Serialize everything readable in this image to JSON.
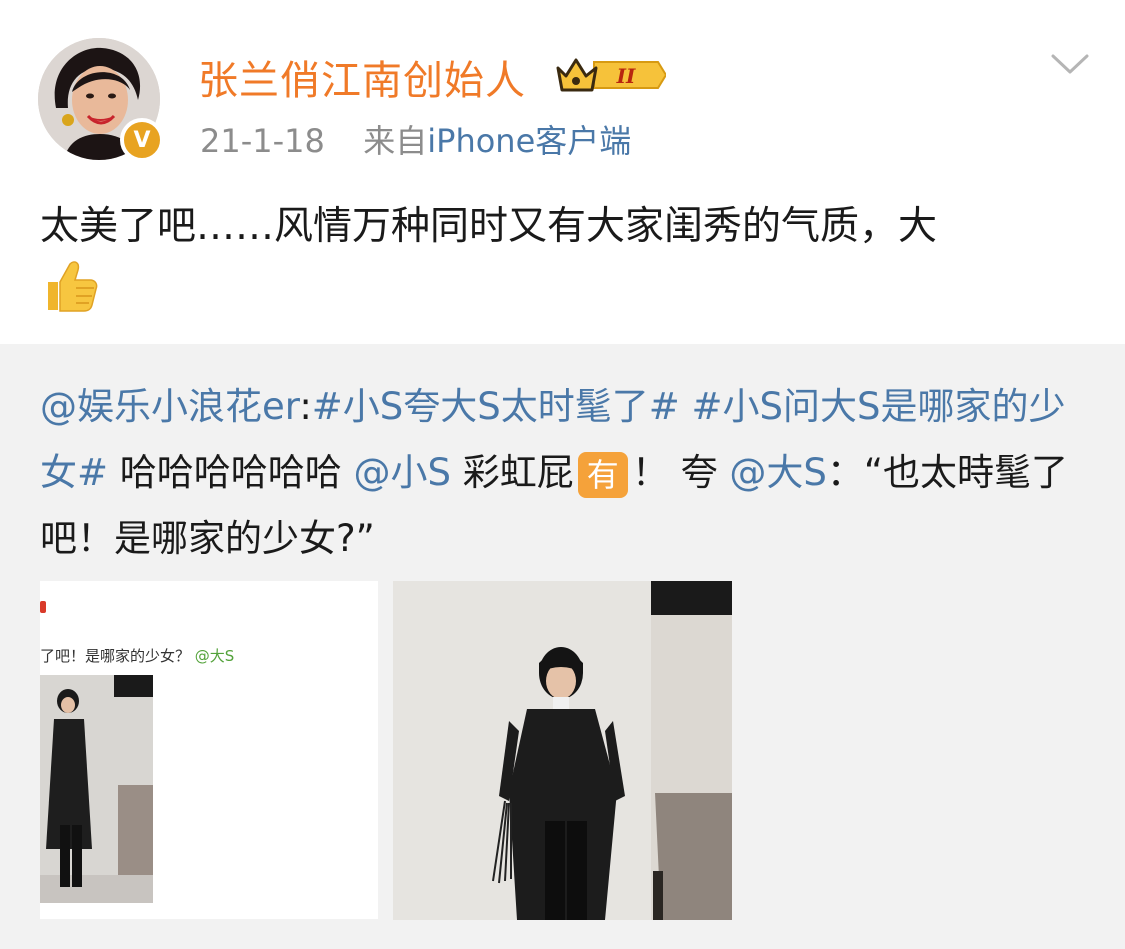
{
  "header": {
    "username": "张兰俏江南创始人",
    "vip_level": "II",
    "verified_mark": "V",
    "date": "21-1-18",
    "source_prefix": "来自",
    "source_device": "iPhone",
    "source_suffix": "客户端"
  },
  "post": {
    "text": "太美了吧……风情万种同时又有大家闺秀的气质，大",
    "emoji": "thumbs-up-icon"
  },
  "repost": {
    "mention_author": "@娱乐小浪花er",
    "colon": ":",
    "hashtag1": "#小S夸大S太时髦了#",
    "hashtag2": "#小S问大S是哪家的少女#",
    "laugh": " 哈哈哈哈哈哈",
    "mention_xiaos": "@小S",
    "phrase": " 彩虹屁",
    "you_badge": "有",
    "exclaim_praise": "！ 夸",
    "mention_das": "@大S",
    "quote": "：“也太時髦了吧！是哪家的少女?”"
  },
  "images": {
    "left_caption": "了吧！是哪家的少女？",
    "left_caption_link": "@大S"
  },
  "colors": {
    "username": "#f07a28",
    "link": "#4a78a8",
    "meta": "#8c8c8c",
    "repost_bg": "#f2f2f2",
    "badge": "#e8a321"
  }
}
